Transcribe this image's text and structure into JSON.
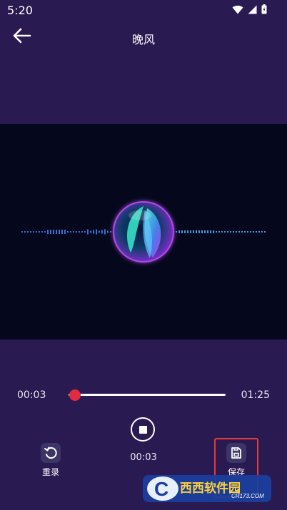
{
  "status_bar": {
    "time": "5:20",
    "icons": [
      "wifi-icon",
      "signal-icon",
      "battery-icon"
    ]
  },
  "header": {
    "title": "晚风",
    "back_icon": "arrow-left-icon"
  },
  "player": {
    "current_time": "00:03",
    "total_time": "01:25",
    "elapsed": "00:03",
    "progress": 0.04,
    "accent_color": "#e22b3f"
  },
  "actions": {
    "retake_label": "重录",
    "retake_icon": "undo-icon",
    "save_label": "保存",
    "save_icon": "save-icon"
  },
  "watermark": {
    "text": "西西软件园",
    "subtext": "CR173.COM"
  }
}
